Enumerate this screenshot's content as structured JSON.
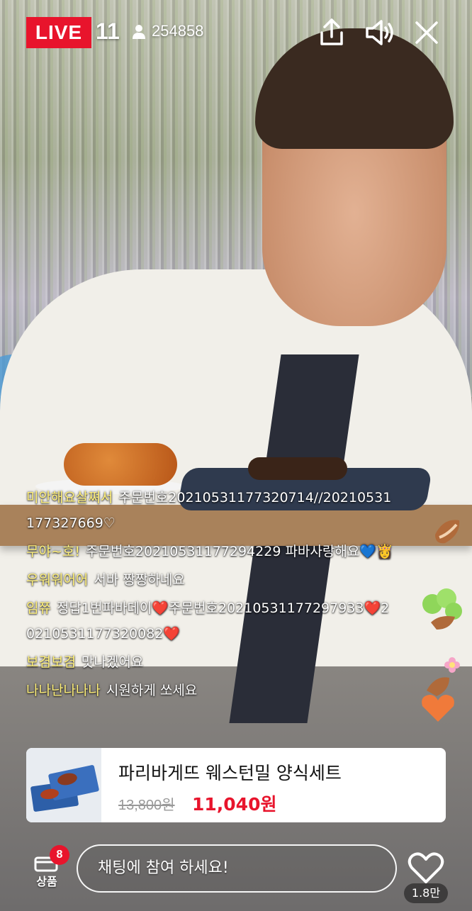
{
  "header": {
    "live_label": "LIVE",
    "live_number": "11",
    "viewer_count": "254858"
  },
  "chat": [
    {
      "user": "미안해요살쪄서",
      "text": "주문번호20210531177320714//20210531177327669♡"
    },
    {
      "user": "무야~호!",
      "text": "주문번호20210531177294229 파바사랑해요💙👸"
    },
    {
      "user": "우워워어어",
      "text": "서바 짱짱하네요"
    },
    {
      "user": "임쮸",
      "text": "정답1번파바데이❤️주문번호20210531177297933❤️20210531177320082❤️"
    },
    {
      "user": "보겸보겸",
      "text": "맛나겠어요"
    },
    {
      "user": "나나난나나나",
      "text": "시원하게 쏘세요"
    }
  ],
  "product": {
    "name": "파리바게뜨 웨스턴밀 양식세트",
    "original_price": "13,800원",
    "sale_price": "11,040원"
  },
  "bottom": {
    "products_label": "상품",
    "products_badge": "8",
    "chat_placeholder": "채팅에 참여 하세요!",
    "like_count": "1.8만"
  },
  "colors": {
    "live_red": "#e8142c",
    "chat_username": "#fff07a",
    "price_red": "#e8142c"
  }
}
